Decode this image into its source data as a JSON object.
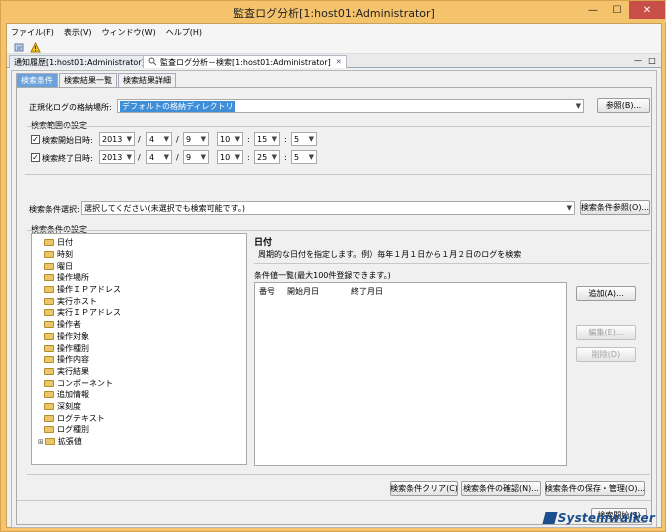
{
  "window": {
    "title": "監査ログ分析[1:host01:Administrator]",
    "min": "—",
    "max": "☐",
    "close": "✕"
  },
  "menu": [
    "ファイル(F)",
    "表示(V)",
    "ウィンドウ(W)",
    "ヘルプ(H)"
  ],
  "editor_tabs": [
    {
      "label": "通知履歴[1:host01:Administrator]"
    },
    {
      "label": "監査ログ分析－検索[1:host01:Administrator]",
      "close": "✕"
    }
  ],
  "view_controls": {
    "minimize": "—",
    "maximize": "□"
  },
  "inner_tabs": [
    "検索条件",
    "検索結果一覧",
    "検索結果詳細"
  ],
  "storage": {
    "label": "正規化ログの格納場所:",
    "value": "デフォルトの格納ディレクトリ",
    "browse_button": "参照(B)..."
  },
  "range": {
    "group_label": "検索範囲の設定",
    "start": {
      "label": "検索開始日時:",
      "checked": true,
      "year": "2013",
      "month": "4",
      "day": "9",
      "hour": "10",
      "minute": "15",
      "second": "5"
    },
    "end": {
      "label": "検索終了日時:",
      "checked": true,
      "year": "2013",
      "month": "4",
      "day": "9",
      "hour": "10",
      "minute": "25",
      "second": "5"
    },
    "date_sep": "/",
    "time_sep": ":"
  },
  "condition_select": {
    "label": "検索条件選択:",
    "value": "選択してください(未選択でも検索可能です。)",
    "ref_button": "検索条件参照(O)..."
  },
  "settings": {
    "group_label": "検索条件の設定",
    "tree": [
      "日付",
      "時刻",
      "曜日",
      "操作場所",
      "操作ＩＰアドレス",
      "実行ホスト",
      "実行ＩＰアドレス",
      "操作者",
      "操作対象",
      "操作種別",
      "操作内容",
      "実行結果",
      "コンポーネント",
      "追加情報",
      "深刻度",
      "ログテキスト",
      "ログ種別",
      "拡張値"
    ],
    "tree_expander": "⊞",
    "detail_title": "日付",
    "detail_desc": "周期的な日付を指定します。例）毎年１月１日から１月２日のログを検索",
    "list_label": "条件値一覧(最大100件登録できます。)",
    "columns": [
      "番号",
      "開始月日",
      "終了月日"
    ],
    "add_button": "追加(A)...",
    "edit_button": "編集(E)...",
    "delete_button": "削除(D)"
  },
  "footer_buttons": {
    "clear": "検索条件クリア(C)",
    "confirm": "検索条件の確認(N)...",
    "save": "検索条件の保存・管理(O)...",
    "start": "検索開始(S)"
  },
  "logo": "Systemwalker"
}
